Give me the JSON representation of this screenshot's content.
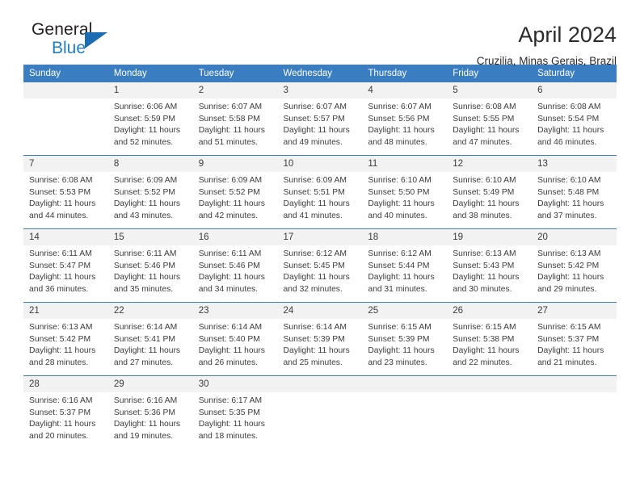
{
  "brand": {
    "name_part1": "General",
    "name_part2": "Blue",
    "logo_icon": "triangle-logo-icon"
  },
  "header": {
    "month_title": "April 2024",
    "location": "Cruzilia, Minas Gerais, Brazil"
  },
  "colors": {
    "header_blue": "#3a7dc0",
    "brand_blue": "#1f7ec4",
    "daynum_background": "#f2f2f2",
    "text": "#3b3b3b"
  },
  "weekdays": [
    "Sunday",
    "Monday",
    "Tuesday",
    "Wednesday",
    "Thursday",
    "Friday",
    "Saturday"
  ],
  "weeks": [
    [
      {
        "day": "",
        "sunrise": "",
        "sunset": "",
        "daylight_line1": "",
        "daylight_line2": ""
      },
      {
        "day": "1",
        "sunrise": "Sunrise: 6:06 AM",
        "sunset": "Sunset: 5:59 PM",
        "daylight_line1": "Daylight: 11 hours",
        "daylight_line2": "and 52 minutes."
      },
      {
        "day": "2",
        "sunrise": "Sunrise: 6:07 AM",
        "sunset": "Sunset: 5:58 PM",
        "daylight_line1": "Daylight: 11 hours",
        "daylight_line2": "and 51 minutes."
      },
      {
        "day": "3",
        "sunrise": "Sunrise: 6:07 AM",
        "sunset": "Sunset: 5:57 PM",
        "daylight_line1": "Daylight: 11 hours",
        "daylight_line2": "and 49 minutes."
      },
      {
        "day": "4",
        "sunrise": "Sunrise: 6:07 AM",
        "sunset": "Sunset: 5:56 PM",
        "daylight_line1": "Daylight: 11 hours",
        "daylight_line2": "and 48 minutes."
      },
      {
        "day": "5",
        "sunrise": "Sunrise: 6:08 AM",
        "sunset": "Sunset: 5:55 PM",
        "daylight_line1": "Daylight: 11 hours",
        "daylight_line2": "and 47 minutes."
      },
      {
        "day": "6",
        "sunrise": "Sunrise: 6:08 AM",
        "sunset": "Sunset: 5:54 PM",
        "daylight_line1": "Daylight: 11 hours",
        "daylight_line2": "and 46 minutes."
      }
    ],
    [
      {
        "day": "7",
        "sunrise": "Sunrise: 6:08 AM",
        "sunset": "Sunset: 5:53 PM",
        "daylight_line1": "Daylight: 11 hours",
        "daylight_line2": "and 44 minutes."
      },
      {
        "day": "8",
        "sunrise": "Sunrise: 6:09 AM",
        "sunset": "Sunset: 5:52 PM",
        "daylight_line1": "Daylight: 11 hours",
        "daylight_line2": "and 43 minutes."
      },
      {
        "day": "9",
        "sunrise": "Sunrise: 6:09 AM",
        "sunset": "Sunset: 5:52 PM",
        "daylight_line1": "Daylight: 11 hours",
        "daylight_line2": "and 42 minutes."
      },
      {
        "day": "10",
        "sunrise": "Sunrise: 6:09 AM",
        "sunset": "Sunset: 5:51 PM",
        "daylight_line1": "Daylight: 11 hours",
        "daylight_line2": "and 41 minutes."
      },
      {
        "day": "11",
        "sunrise": "Sunrise: 6:10 AM",
        "sunset": "Sunset: 5:50 PM",
        "daylight_line1": "Daylight: 11 hours",
        "daylight_line2": "and 40 minutes."
      },
      {
        "day": "12",
        "sunrise": "Sunrise: 6:10 AM",
        "sunset": "Sunset: 5:49 PM",
        "daylight_line1": "Daylight: 11 hours",
        "daylight_line2": "and 38 minutes."
      },
      {
        "day": "13",
        "sunrise": "Sunrise: 6:10 AM",
        "sunset": "Sunset: 5:48 PM",
        "daylight_line1": "Daylight: 11 hours",
        "daylight_line2": "and 37 minutes."
      }
    ],
    [
      {
        "day": "14",
        "sunrise": "Sunrise: 6:11 AM",
        "sunset": "Sunset: 5:47 PM",
        "daylight_line1": "Daylight: 11 hours",
        "daylight_line2": "and 36 minutes."
      },
      {
        "day": "15",
        "sunrise": "Sunrise: 6:11 AM",
        "sunset": "Sunset: 5:46 PM",
        "daylight_line1": "Daylight: 11 hours",
        "daylight_line2": "and 35 minutes."
      },
      {
        "day": "16",
        "sunrise": "Sunrise: 6:11 AM",
        "sunset": "Sunset: 5:46 PM",
        "daylight_line1": "Daylight: 11 hours",
        "daylight_line2": "and 34 minutes."
      },
      {
        "day": "17",
        "sunrise": "Sunrise: 6:12 AM",
        "sunset": "Sunset: 5:45 PM",
        "daylight_line1": "Daylight: 11 hours",
        "daylight_line2": "and 32 minutes."
      },
      {
        "day": "18",
        "sunrise": "Sunrise: 6:12 AM",
        "sunset": "Sunset: 5:44 PM",
        "daylight_line1": "Daylight: 11 hours",
        "daylight_line2": "and 31 minutes."
      },
      {
        "day": "19",
        "sunrise": "Sunrise: 6:13 AM",
        "sunset": "Sunset: 5:43 PM",
        "daylight_line1": "Daylight: 11 hours",
        "daylight_line2": "and 30 minutes."
      },
      {
        "day": "20",
        "sunrise": "Sunrise: 6:13 AM",
        "sunset": "Sunset: 5:42 PM",
        "daylight_line1": "Daylight: 11 hours",
        "daylight_line2": "and 29 minutes."
      }
    ],
    [
      {
        "day": "21",
        "sunrise": "Sunrise: 6:13 AM",
        "sunset": "Sunset: 5:42 PM",
        "daylight_line1": "Daylight: 11 hours",
        "daylight_line2": "and 28 minutes."
      },
      {
        "day": "22",
        "sunrise": "Sunrise: 6:14 AM",
        "sunset": "Sunset: 5:41 PM",
        "daylight_line1": "Daylight: 11 hours",
        "daylight_line2": "and 27 minutes."
      },
      {
        "day": "23",
        "sunrise": "Sunrise: 6:14 AM",
        "sunset": "Sunset: 5:40 PM",
        "daylight_line1": "Daylight: 11 hours",
        "daylight_line2": "and 26 minutes."
      },
      {
        "day": "24",
        "sunrise": "Sunrise: 6:14 AM",
        "sunset": "Sunset: 5:39 PM",
        "daylight_line1": "Daylight: 11 hours",
        "daylight_line2": "and 25 minutes."
      },
      {
        "day": "25",
        "sunrise": "Sunrise: 6:15 AM",
        "sunset": "Sunset: 5:39 PM",
        "daylight_line1": "Daylight: 11 hours",
        "daylight_line2": "and 23 minutes."
      },
      {
        "day": "26",
        "sunrise": "Sunrise: 6:15 AM",
        "sunset": "Sunset: 5:38 PM",
        "daylight_line1": "Daylight: 11 hours",
        "daylight_line2": "and 22 minutes."
      },
      {
        "day": "27",
        "sunrise": "Sunrise: 6:15 AM",
        "sunset": "Sunset: 5:37 PM",
        "daylight_line1": "Daylight: 11 hours",
        "daylight_line2": "and 21 minutes."
      }
    ],
    [
      {
        "day": "28",
        "sunrise": "Sunrise: 6:16 AM",
        "sunset": "Sunset: 5:37 PM",
        "daylight_line1": "Daylight: 11 hours",
        "daylight_line2": "and 20 minutes."
      },
      {
        "day": "29",
        "sunrise": "Sunrise: 6:16 AM",
        "sunset": "Sunset: 5:36 PM",
        "daylight_line1": "Daylight: 11 hours",
        "daylight_line2": "and 19 minutes."
      },
      {
        "day": "30",
        "sunrise": "Sunrise: 6:17 AM",
        "sunset": "Sunset: 5:35 PM",
        "daylight_line1": "Daylight: 11 hours",
        "daylight_line2": "and 18 minutes."
      },
      {
        "day": "",
        "sunrise": "",
        "sunset": "",
        "daylight_line1": "",
        "daylight_line2": ""
      },
      {
        "day": "",
        "sunrise": "",
        "sunset": "",
        "daylight_line1": "",
        "daylight_line2": ""
      },
      {
        "day": "",
        "sunrise": "",
        "sunset": "",
        "daylight_line1": "",
        "daylight_line2": ""
      },
      {
        "day": "",
        "sunrise": "",
        "sunset": "",
        "daylight_line1": "",
        "daylight_line2": ""
      }
    ]
  ]
}
